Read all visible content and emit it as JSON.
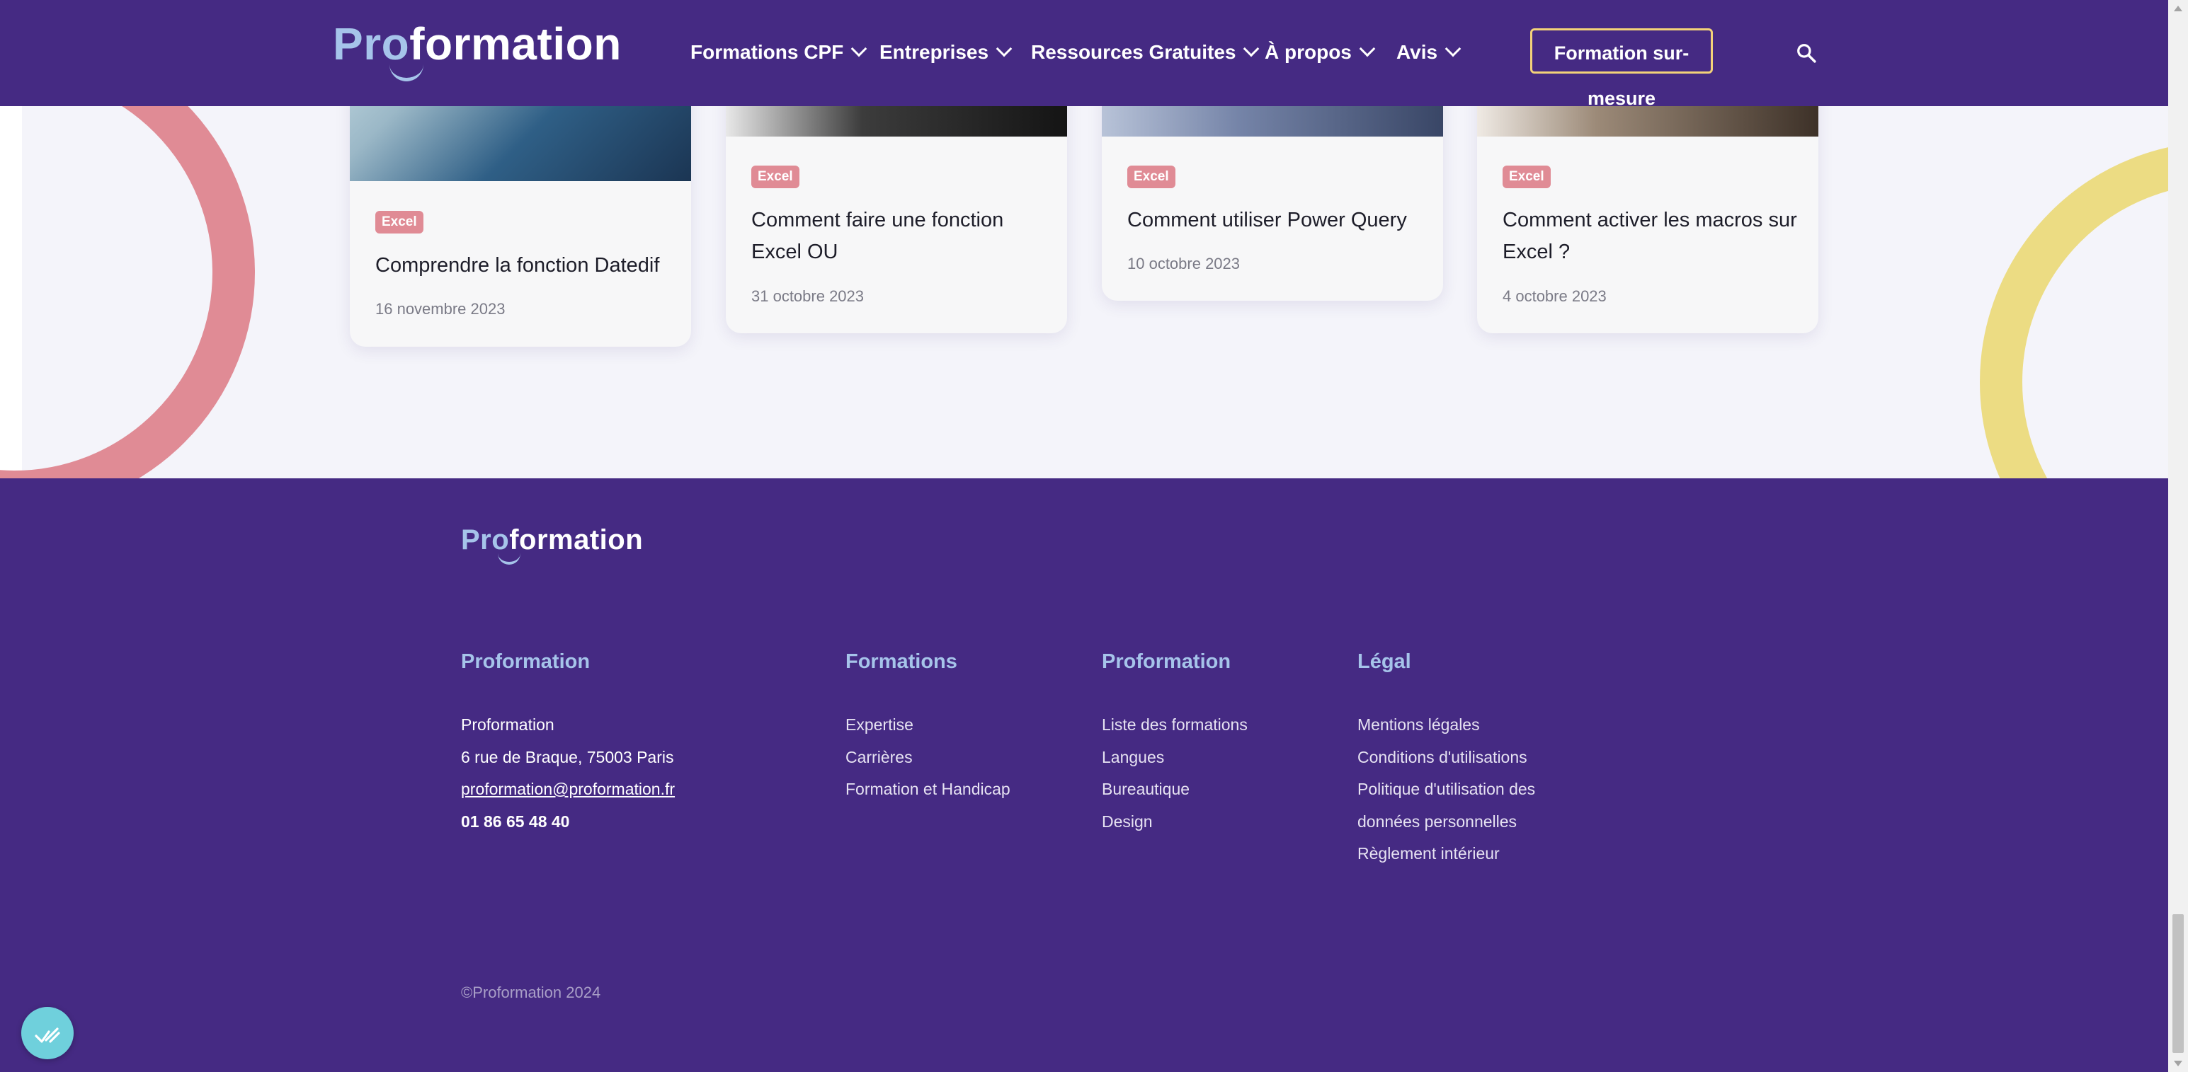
{
  "brand": {
    "logo_pro": "Pro",
    "logo_formation": "formation",
    "colors": {
      "primary": "#452a83",
      "accent_light_blue": "#a6c4ea",
      "badge_pink": "#e08b95",
      "cta_border_yellow": "#f3d279",
      "ring_pink": "#e08b95",
      "ring_yellow": "#ecdc83"
    }
  },
  "header": {
    "nav": [
      {
        "label": "Formations CPF"
      },
      {
        "label": "Entreprises"
      },
      {
        "label": "Ressources Gratuites"
      },
      {
        "label": "À propos"
      },
      {
        "label": "Avis"
      }
    ],
    "cta_label": "Formation sur-mesure",
    "search_icon": "search-icon"
  },
  "articles": [
    {
      "tag": "Excel",
      "title": "Comprendre la fonction Datedif",
      "date": "16 novembre 2023"
    },
    {
      "tag": "Excel",
      "title": "Comment faire une fonction Excel OU",
      "date": "31 octobre 2023"
    },
    {
      "tag": "Excel",
      "title": "Comment utiliser Power Query",
      "date": "10 octobre 2023"
    },
    {
      "tag": "Excel",
      "title": "Comment activer les macros sur Excel ?",
      "date": "4 octobre 2023"
    }
  ],
  "footer": {
    "columns": [
      {
        "heading": "Proformation",
        "items": [
          "Proformation",
          "6 rue de Braque, 75003 Paris",
          "proformation@proformation.fr",
          "01 86 65 48 40"
        ]
      },
      {
        "heading": "Formations",
        "items": [
          "Expertise",
          "Carrières",
          "Formation et Handicap"
        ]
      },
      {
        "heading": "Proformation",
        "items": [
          "Liste des formations",
          "Langues",
          "Bureautique",
          "Design"
        ]
      },
      {
        "heading": "Légal",
        "items": [
          "Mentions légales",
          "Conditions d'utilisations",
          "Politique d'utilisation des",
          "données personnelles",
          "Règlement intérieur"
        ]
      }
    ],
    "copyright": "©Proformation 2024"
  },
  "widget_icon": "accessibility-widget-icon"
}
